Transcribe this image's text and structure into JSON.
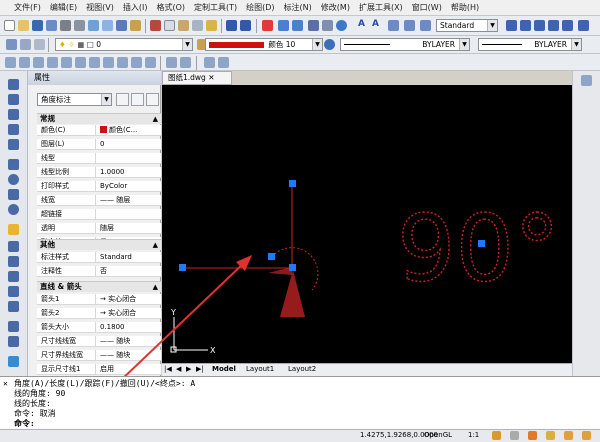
{
  "menu": [
    "文件(F)",
    "编辑(E)",
    "视图(V)",
    "插入(I)",
    "格式(O)",
    "定制工具(T)",
    "绘图(D)",
    "标注(N)",
    "修改(M)",
    "扩展工具(X)",
    "窗口(W)",
    "帮助(H)"
  ],
  "toolbar": {
    "text_style": "Standard",
    "layer_value": "0",
    "color_label": "颜色 10",
    "linetype": "BYLAYER",
    "lineweight": "BYLAYER",
    "font_a1": "A",
    "font_a2": "A"
  },
  "properties": {
    "title": "属性",
    "filter": "角度标注",
    "sections": {
      "general": "常规",
      "misc": "其他",
      "arrows": "直线 & 箭头"
    },
    "general_rows": [
      {
        "key": "颜色(C)",
        "value": "颜色(C..."
      },
      {
        "key": "图层(L)",
        "value": "0"
      },
      {
        "key": "线型",
        "value": ""
      },
      {
        "key": "线型比例",
        "value": "1.0000"
      },
      {
        "key": "打印样式",
        "value": "ByColor"
      },
      {
        "key": "线宽",
        "value": "—— 随层"
      },
      {
        "key": "超链接",
        "value": ""
      },
      {
        "key": "透明",
        "value": "随层"
      },
      {
        "key": "联合的",
        "value": "是"
      }
    ],
    "misc_rows": [
      {
        "key": "标注样式",
        "value": "Standard"
      },
      {
        "key": "注释性",
        "value": "否"
      }
    ],
    "arrow_rows": [
      {
        "key": "箭头1",
        "value": "→ 实心闭合"
      },
      {
        "key": "箭头2",
        "value": "→ 实心闭合"
      },
      {
        "key": "箭头大小",
        "value": "0.1800"
      },
      {
        "key": "尺寸线线宽",
        "value": "—— 随块"
      },
      {
        "key": "尺寸界线线宽",
        "value": "—— 随块"
      },
      {
        "key": "显示尺寸线1",
        "value": "启用"
      },
      {
        "key": "显示尺寸线2",
        "value": "启用"
      }
    ],
    "toggle_open": "▲",
    "toggle_closed": "▼"
  },
  "document_tab": "图纸1.dwg",
  "layout_tabs": [
    "Model",
    "Layout1",
    "Layout2"
  ],
  "drawing": {
    "dimension_text": "90°",
    "axis_x": "X",
    "axis_y": "Y"
  },
  "command_lines": [
    "角度(A)/长度(L)/跟踪(F)/撤回(U)/<终点>: A",
    "线的角度: 90",
    "线的长度:",
    "命令:  取消",
    "命令:"
  ],
  "status": {
    "coords": "1.4275,1.9268,0.0000",
    "renderer": "OpenGL",
    "scale": "1:1"
  },
  "colors": {
    "selection_grip": "#1e7bff",
    "dashed_red": "#d02222",
    "layer_color": "#cc1111"
  }
}
